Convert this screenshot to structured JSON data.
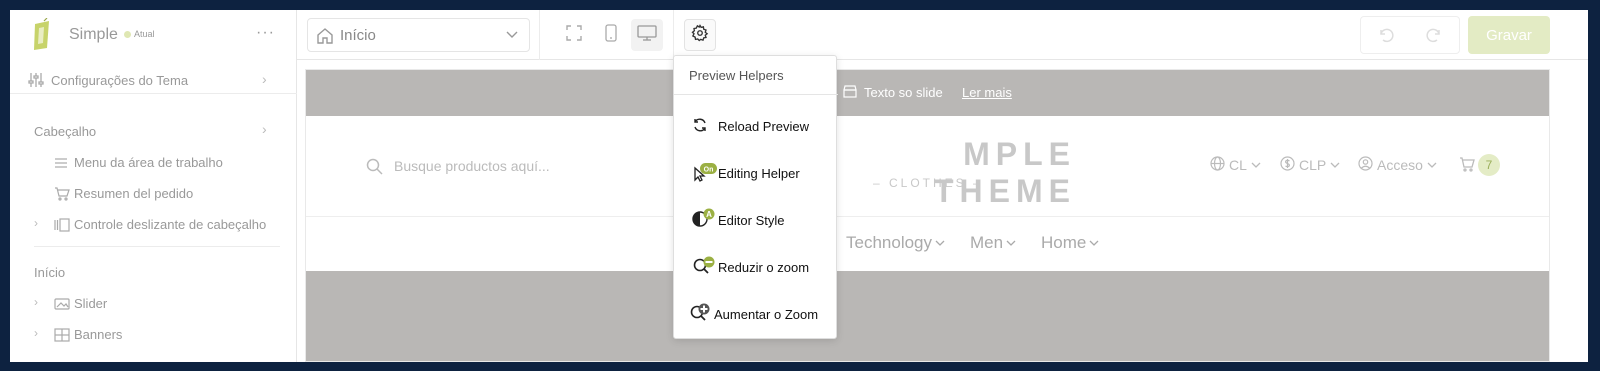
{
  "brand": {
    "name": "Simple",
    "badge": "Atual"
  },
  "sidebar": {
    "theme_settings": "Configurações do Tema",
    "section_header": "Cabeçalho",
    "header_items": [
      {
        "label": "Menu da área de trabalho"
      },
      {
        "label": "Resumen del pedido"
      },
      {
        "label": "Controle deslizante de cabeçalho"
      }
    ],
    "section_home": "Início",
    "home_items": [
      {
        "label": "Slider"
      },
      {
        "label": "Banners"
      }
    ]
  },
  "toolbar": {
    "page_select_value": "Início",
    "save_label": "Gravar"
  },
  "preview_menu": {
    "title": "Preview Helpers",
    "items": [
      {
        "label": "Reload Preview",
        "icon": "reload-icon"
      },
      {
        "label": "Editing Helper",
        "icon": "editing-helper-icon"
      },
      {
        "label": "Editor Style",
        "icon": "editor-style-icon"
      },
      {
        "label": "Reduzir o zoom",
        "icon": "zoom-out-icon"
      },
      {
        "label": "Aumentar o Zoom",
        "icon": "zoom-in-icon"
      }
    ]
  },
  "store_preview": {
    "announcement_text": "Texto so slide",
    "announcement_link": "Ler mais",
    "search_placeholder": "Busque productos aquí...",
    "logo_title": "MPLE THEME",
    "logo_subtitle": "– CLOTHES –",
    "country": "CL",
    "currency": "CLP",
    "account": "Acceso",
    "cart_count": "7",
    "nav": [
      "Technology",
      "Men",
      "Home"
    ]
  },
  "colors": {
    "accent": "#9bb043",
    "save_bg": "#e3ebc4",
    "banner_gray": "#b9b7b5"
  }
}
